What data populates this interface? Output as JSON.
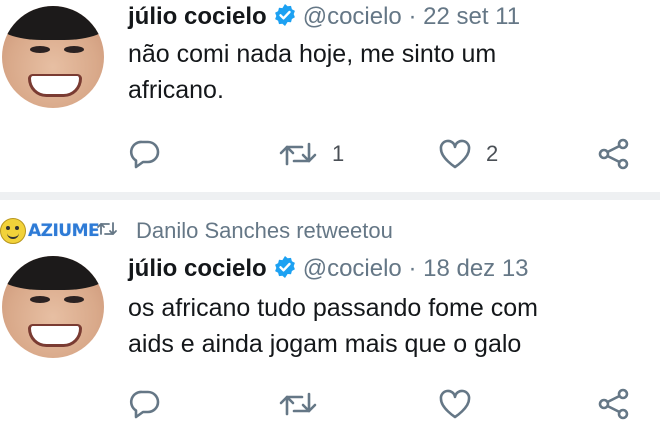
{
  "tweets": [
    {
      "name": "júlio cocielo",
      "handle": "@cocielo",
      "date": "22 set 11",
      "text": "não comi nada hoje, me sinto um\nafricano.",
      "replies": "",
      "retweets": "1",
      "likes": "2"
    },
    {
      "retweeted_by": "Danilo Sanches retweetou",
      "name": "júlio cocielo",
      "handle": "@cocielo",
      "date": "18 dez 13",
      "text": "os africano tudo passando fome com\naids e ainda jogam mais que o galo"
    }
  ],
  "watermark": {
    "brand": "AZIUME"
  },
  "colors": {
    "verified": "#1da1f2",
    "muted": "#657786",
    "text": "#14171a",
    "divider": "#eef0f2"
  },
  "icons": [
    "verified-badge-icon",
    "reply-icon",
    "retweet-icon",
    "like-icon",
    "share-icon",
    "retweet-small-icon",
    "smiley-logo-icon"
  ]
}
